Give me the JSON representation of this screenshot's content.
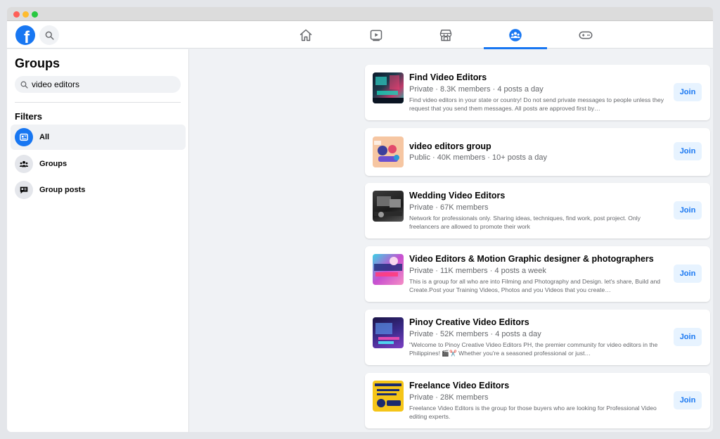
{
  "sidebar": {
    "title": "Groups",
    "search_value": "video editors",
    "filters_title": "Filters",
    "filters": [
      {
        "label": "All",
        "active": true
      },
      {
        "label": "Groups",
        "active": false
      },
      {
        "label": "Group posts",
        "active": false
      }
    ]
  },
  "nav": {
    "tabs": [
      {
        "icon": "home-icon"
      },
      {
        "icon": "watch-icon"
      },
      {
        "icon": "marketplace-icon"
      },
      {
        "icon": "groups-icon",
        "active": true
      },
      {
        "icon": "gaming-icon"
      }
    ]
  },
  "results": [
    {
      "name": "Find Video Editors",
      "meta": "Private · 8.3K members · 4 posts a day",
      "description": "Find video editors in your state or country! Do not send private messages to people unless they request that you send them messages. All posts are approved first by…",
      "join_label": "Join"
    },
    {
      "name": "video editors group",
      "meta": "Public · 40K members · 10+ posts a day",
      "description": "",
      "join_label": "Join"
    },
    {
      "name": "Wedding Video Editors",
      "meta": "Private · 67K members",
      "description": "Network for professionals only. Sharing ideas, techniques, find work, post project. Only freelancers are allowed to promote their work",
      "join_label": "Join"
    },
    {
      "name": "Video Editors & Motion Graphic designer & photographers",
      "meta": "Private · 11K members · 4 posts a week",
      "description": "This is a group for all who are into Filming and Photography and Design. let's share, Build and Create.Post your Training Videos, Photos and you Videos that you create…",
      "join_label": "Join"
    },
    {
      "name": "Pinoy Creative Video Editors",
      "meta": "Private · 52K members · 4 posts a day",
      "description": "\"Welcome to Pinoy Creative Video Editors PH, the premier community for video editors in the Philippines! 🎬✂️ Whether you're a seasoned professional or just…",
      "join_label": "Join"
    },
    {
      "name": "Freelance Video Editors",
      "meta": "Private · 28K members",
      "description": "Freelance Video Editors is the group for those buyers who are looking for Professional Video editing experts.",
      "join_label": "Join"
    }
  ],
  "colors": {
    "accent": "#1877f2",
    "join_bg": "#e7f3ff",
    "page_bg": "#f0f2f5"
  }
}
